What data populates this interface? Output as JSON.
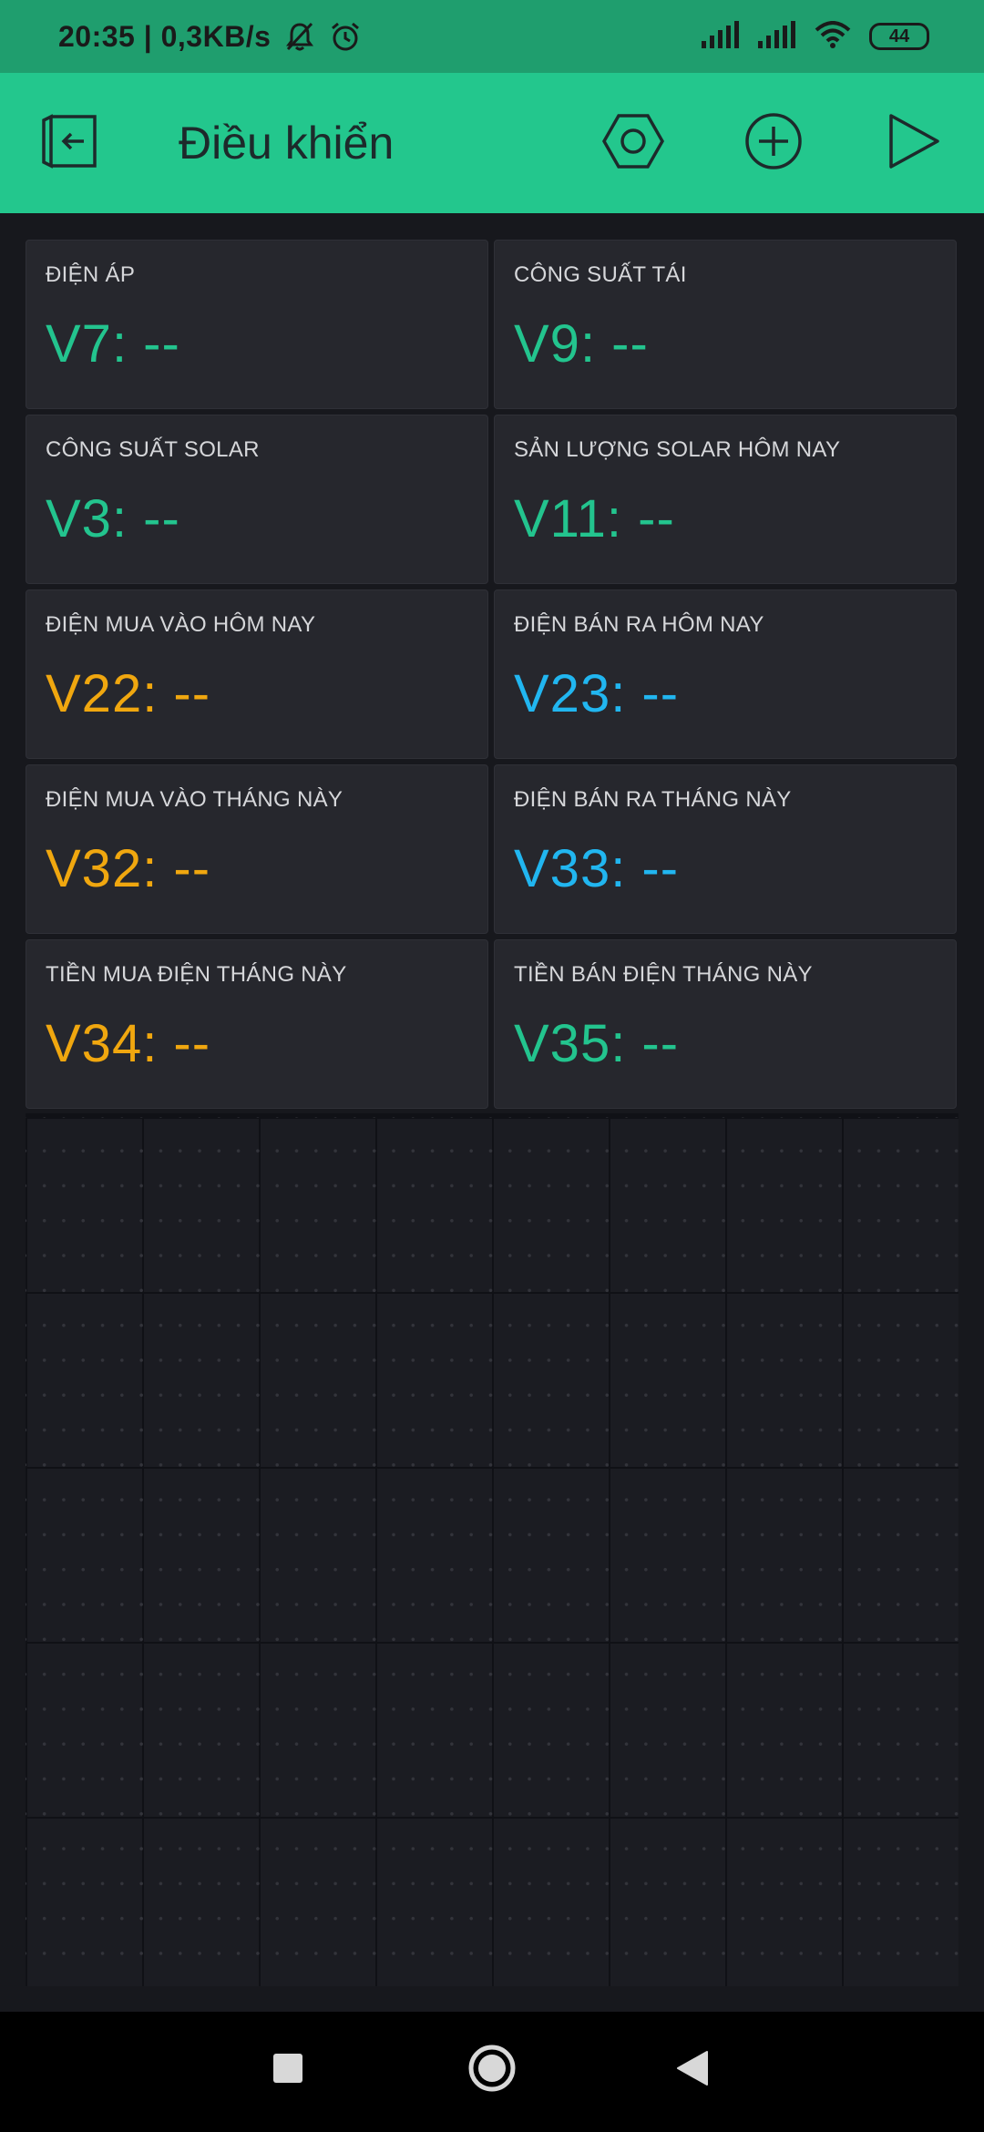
{
  "status_bar": {
    "time_speed": "20:35 | 0,3KB/s",
    "battery": "44",
    "icons": [
      "muted-bell-icon",
      "alarm-icon",
      "signal-icon",
      "signal-icon",
      "wifi-icon",
      "battery-icon"
    ]
  },
  "app_bar": {
    "title": "Điều khiển",
    "icons": [
      "exit-icon",
      "settings-hex-icon",
      "add-icon",
      "play-icon"
    ]
  },
  "colors": {
    "status_bar": "#1f9e6e",
    "app_bar": "#23c78d",
    "green": "#23c48e",
    "orange": "#f0a70f",
    "blue": "#21b6f0"
  },
  "widgets": [
    {
      "label": "ĐIỆN ÁP",
      "value": "V7: --",
      "color": "green"
    },
    {
      "label": "CÔNG SUẤT TÁI",
      "value": "V9: --",
      "color": "green"
    },
    {
      "label": "CÔNG SUẤT SOLAR",
      "value": "V3: --",
      "color": "green"
    },
    {
      "label": "SẢN LƯỢNG SOLAR HÔM NAY",
      "value": "V11: --",
      "color": "green"
    },
    {
      "label": "ĐIỆN MUA VÀO HÔM NAY",
      "value": "V22: --",
      "color": "orange"
    },
    {
      "label": "ĐIỆN BÁN RA HÔM NAY",
      "value": "V23: --",
      "color": "blue"
    },
    {
      "label": "ĐIỆN MUA VÀO THÁNG NÀY",
      "value": "V32: --",
      "color": "orange"
    },
    {
      "label": "ĐIỆN BÁN RA THÁNG NÀY",
      "value": "V33: --",
      "color": "blue"
    },
    {
      "label": "TIỀN MUA ĐIỆN THÁNG NÀY",
      "value": "V34: --",
      "color": "orange"
    },
    {
      "label": "TIỀN BÁN ĐIỆN THÁNG NÀY",
      "value": "V35: --",
      "color": "green"
    }
  ],
  "nav_bar": {
    "icons": [
      "recents-square-icon",
      "home-circle-icon",
      "back-triangle-icon"
    ]
  }
}
